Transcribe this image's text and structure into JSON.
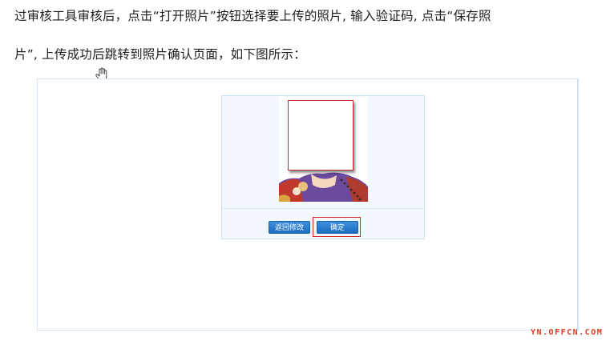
{
  "paragraph": {
    "line1": "过审核工具审核后，点击“打开照片”按钮选择要上传的照片, 输入验证码, 点击“保存照",
    "line2": "片”, 上传成功后跳转到照片确认页面，如下图所示："
  },
  "confirm_panel": {
    "back_button_label": "返回修改",
    "confirm_button_label": "确定"
  },
  "watermark": "YN.OFFCN.COM",
  "colors": {
    "highlight": "#d12525",
    "button": "#2a7bd0",
    "frame_border": "#d7e6f3"
  }
}
